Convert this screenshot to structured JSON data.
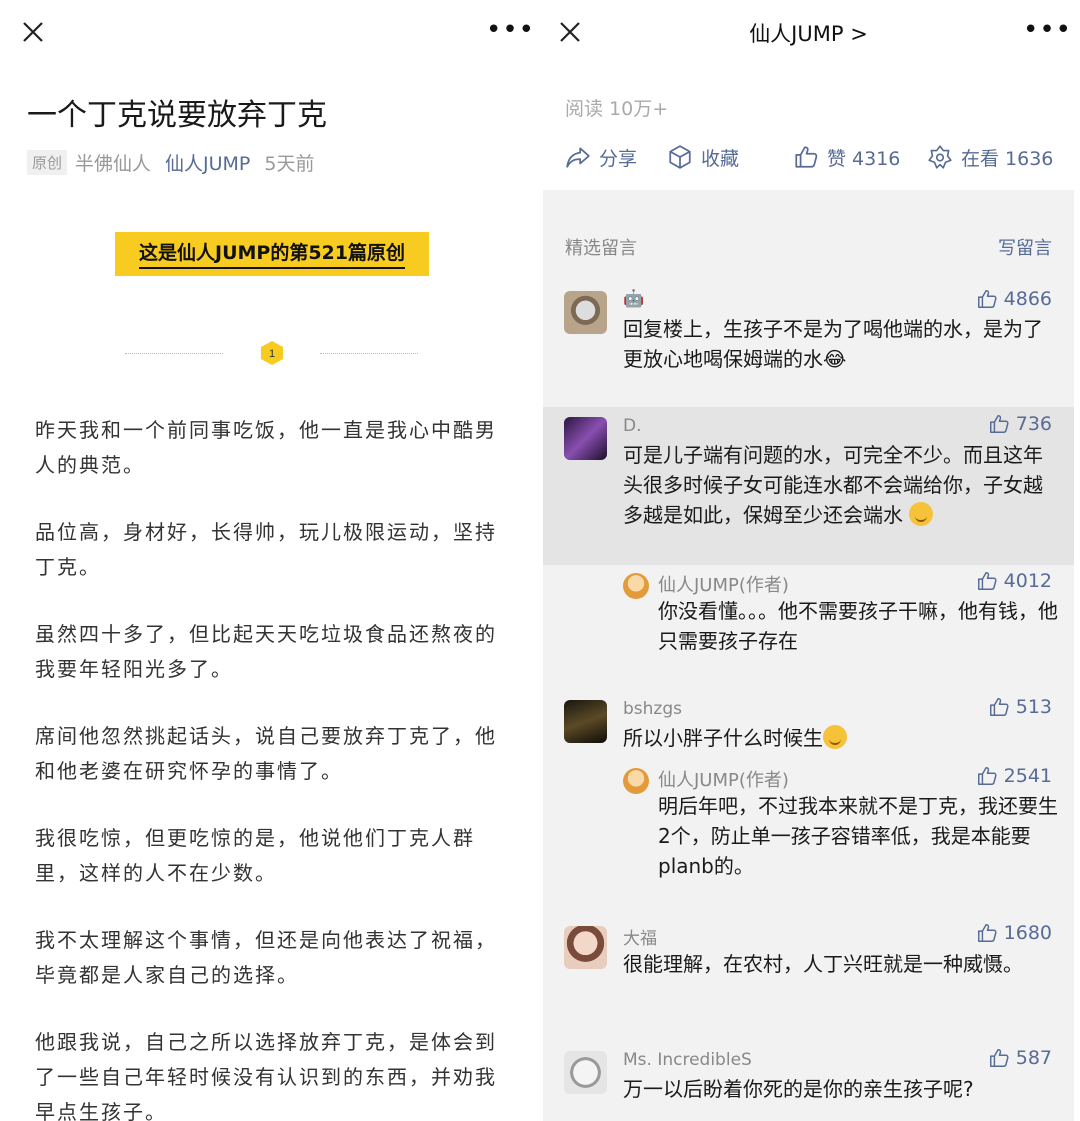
{
  "left": {
    "title": "一个丁克说要放弃丁克",
    "meta": {
      "tag": "原创",
      "author": "半佛仙人",
      "account": "仙人JUMP",
      "time": "5天前"
    },
    "banner": "这是仙人JUMP的第521篇原创",
    "section_number": "1",
    "paragraphs": [
      "昨天我和一个前同事吃饭，他一直是我心中酷男人的典范。",
      "品位高，身材好，长得帅，玩儿极限运动，坚持丁克。",
      "虽然四十多了，但比起天天吃垃圾食品还熬夜的我要年轻阳光多了。",
      "席间他忽然挑起话头，说自己要放弃丁克了，他和他老婆在研究怀孕的事情了。",
      "我很吃惊，但更吃惊的是，他说他们丁克人群里，这样的人不在少数。",
      "我不太理解这个事情，但还是向他表达了祝福，毕竟都是人家自己的选择。",
      "他跟我说，自己之所以选择放弃丁克，是体会到了一些自己年轻时候没有认识到的东西，并劝我早点生孩子。"
    ]
  },
  "right": {
    "title": "仙人JUMP >",
    "reads": "阅读 10万+",
    "actions": {
      "share": "分享",
      "favorite": "收藏",
      "like": "赞 4316",
      "watching": "在看 1636"
    },
    "selected_label": "精选留言",
    "write_label": "写留言",
    "comments": [
      {
        "name": "🤖",
        "likes": "4866",
        "text": "回复楼上，生孩子不是为了喝他端的水，是为了更放心地喝保姆端的水😂"
      },
      {
        "name": "D.",
        "likes": "736",
        "text": "可是儿子端有问题的水，可完全不少。而且这年头很多时候子女可能连水都不会端给你，子女越多越是如此，保姆至少还会端水"
      },
      {
        "reply_name": "仙人JUMP(作者)",
        "reply_likes": "4012",
        "reply_text": "你没看懂。。。他不需要孩子干嘛，他有钱，他只需要孩子存在"
      },
      {
        "name": "bshzgs",
        "likes": "513",
        "text": "所以小胖子什么时候生"
      },
      {
        "reply_name": "仙人JUMP(作者)",
        "reply_likes": "2541",
        "reply_text": "明后年吧，不过我本来就不是丁克，我还要生2个，防止单一孩子容错率低，我是本能要planb的。"
      },
      {
        "name": "大福",
        "likes": "1680",
        "text": "很能理解，在农村，人丁兴旺就是一种威慑。"
      },
      {
        "name": "Ms. IncredibleS",
        "likes": "587",
        "text": "万一以后盼着你死的是你的亲生孩子呢?"
      }
    ]
  },
  "colors": {
    "link": "#576b95",
    "banner": "#f7cb1f",
    "gray_bg": "#f2f2f2",
    "highlight_bg": "#e4e4e4"
  }
}
